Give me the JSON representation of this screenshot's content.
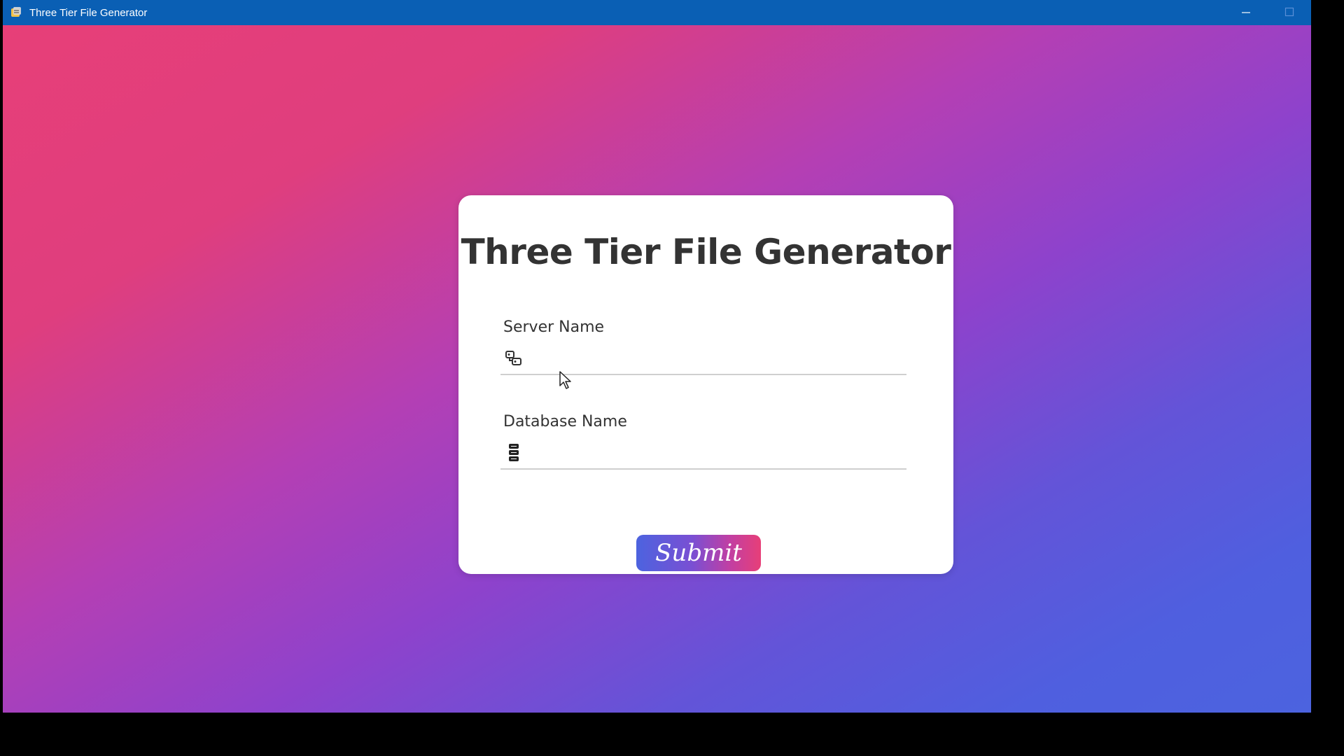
{
  "window": {
    "title": "Three Tier File Generator"
  },
  "form": {
    "heading": "Three Tier File Generator",
    "server_label": "Server Name",
    "server_value": "",
    "database_label": "Database Name",
    "database_value": "",
    "submit_label": "Submit"
  },
  "icons": {
    "app": "app-icon",
    "server": "server-icon",
    "database": "database-icon",
    "minimize": "minimize-icon",
    "maximize": "maximize-icon"
  },
  "colors": {
    "titlebar": "#0a5fb4",
    "gradient_start": "#e73f78",
    "gradient_end": "#4c63df",
    "card": "#ffffff",
    "text": "#333333"
  }
}
